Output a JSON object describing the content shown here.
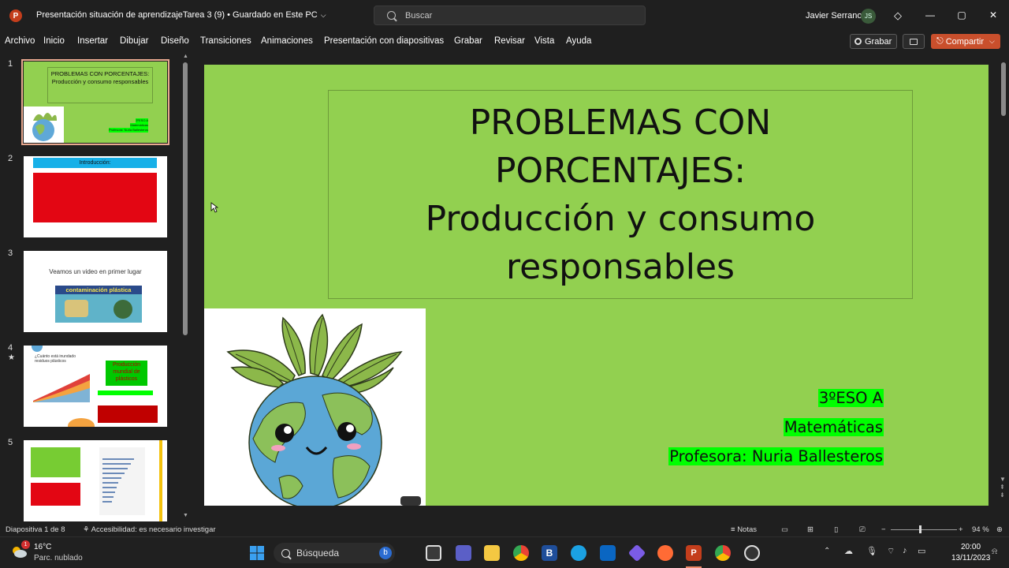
{
  "window": {
    "document_title": "Presentación situación de aprendizajeTarea 3 (9) • Guardado en Este PC",
    "search_placeholder": "Buscar",
    "user_name": "Javier Serrano",
    "user_initials": "JS"
  },
  "ribbon": {
    "tabs": [
      "Archivo",
      "Inicio",
      "Insertar",
      "Dibujar",
      "Diseño",
      "Transiciones",
      "Animaciones",
      "Presentación con diapositivas",
      "Grabar",
      "Revisar",
      "Vista",
      "Ayuda"
    ],
    "record_label": "Grabar",
    "share_label": "Compartir"
  },
  "thumbnails": {
    "numbers": [
      "1",
      "2",
      "3",
      "4",
      "5"
    ],
    "active_index": 1,
    "slide1": {
      "title": "PROBLEMAS CON PORCENTAJES: Producción y consumo responsables",
      "info": [
        "3ºESO A",
        "Matemáticas",
        "Profesora: Nuria Ballesteros"
      ]
    },
    "slide2_title": "Introducción:",
    "slide3_text": "Veamos un video en primer lugar",
    "slide3_video_title": "contaminación plástica",
    "slide4_box": "Producción mundial de plásticos",
    "slide4_chart_title": "¿Cuánto está inundado residuos plásticos"
  },
  "slide": {
    "title_lines": [
      "PROBLEMAS CON",
      "PORCENTAJES:",
      "Producción y consumo",
      "responsables"
    ],
    "info_lines": [
      "3ºESO A",
      "Matemáticas",
      "Profesora: Nuria Ballesteros"
    ],
    "colors": {
      "background": "#92d050",
      "highlight": "#00ff00"
    }
  },
  "status": {
    "slide_count": "Diapositiva 1 de 8",
    "accessibility": "Accesibilidad: es necesario investigar",
    "notes": "Notas",
    "zoom": "94 %"
  },
  "taskbar": {
    "weather_temp": "16°C",
    "weather_desc": "Parc. nublado",
    "search": "Búsqueda",
    "time": "20:00",
    "date": "13/11/2023",
    "weather_badge": "1"
  }
}
